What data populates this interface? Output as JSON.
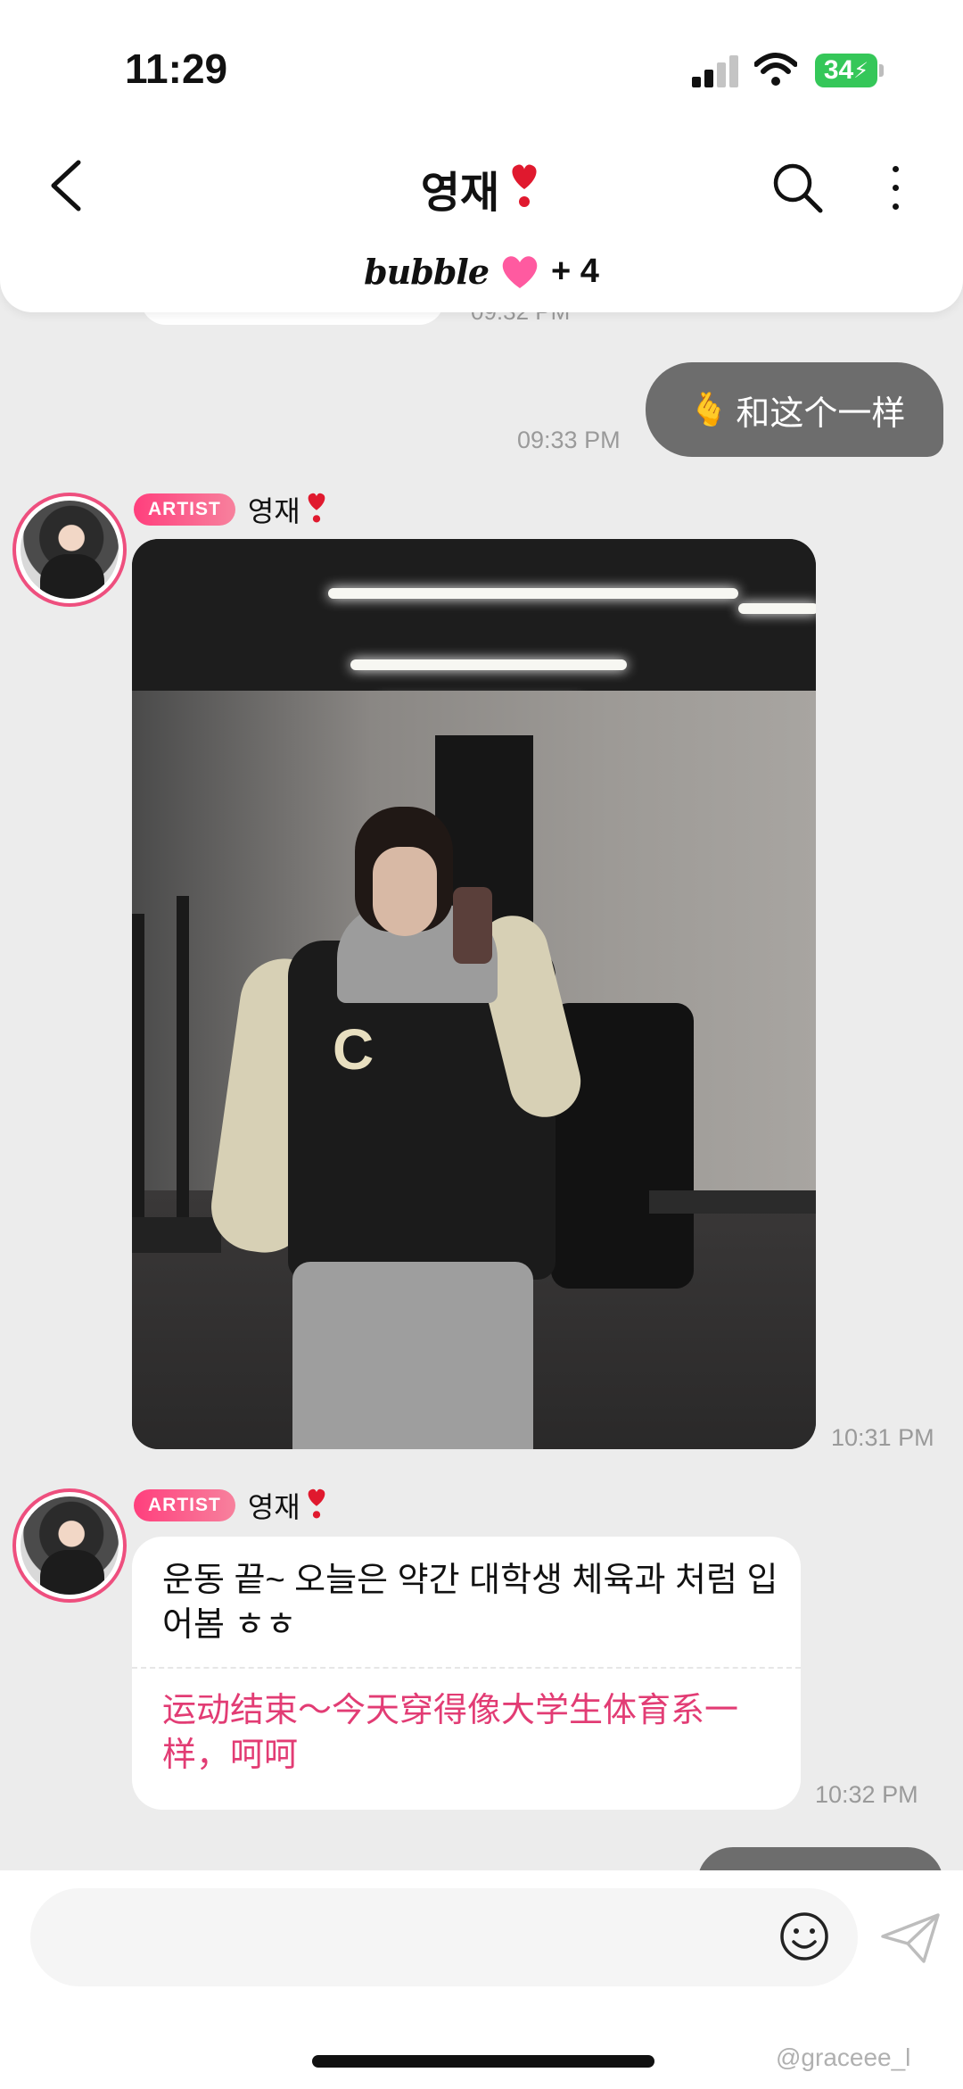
{
  "status_bar": {
    "time": "11:29",
    "battery": "34"
  },
  "header": {
    "title": "영재",
    "brand": "bubble",
    "member_count": "+ 4"
  },
  "messages": {
    "peek_time": "09:32 PM",
    "me": {
      "text": "和这个一样",
      "emoji": "🫰",
      "time": "09:33 PM"
    },
    "artist_1": {
      "badge": "ARTIST",
      "name": "영재",
      "time": "10:31 PM"
    },
    "artist_2": {
      "badge": "ARTIST",
      "name": "영재",
      "text_ko": "운동 끝~ 오늘은 약간 대학생 체육과 처럼 입어봄 ㅎㅎ",
      "text_zh": "运动结束～今天穿得像大学生体育系一样，呵呵",
      "time": "10:32 PM"
    }
  },
  "composer": {
    "placeholder": ""
  },
  "watermark": "@graceee_l",
  "colors": {
    "accent": "#ee4f7e",
    "translation": "#e23c74",
    "my_bubble": "#6d6d6d"
  }
}
